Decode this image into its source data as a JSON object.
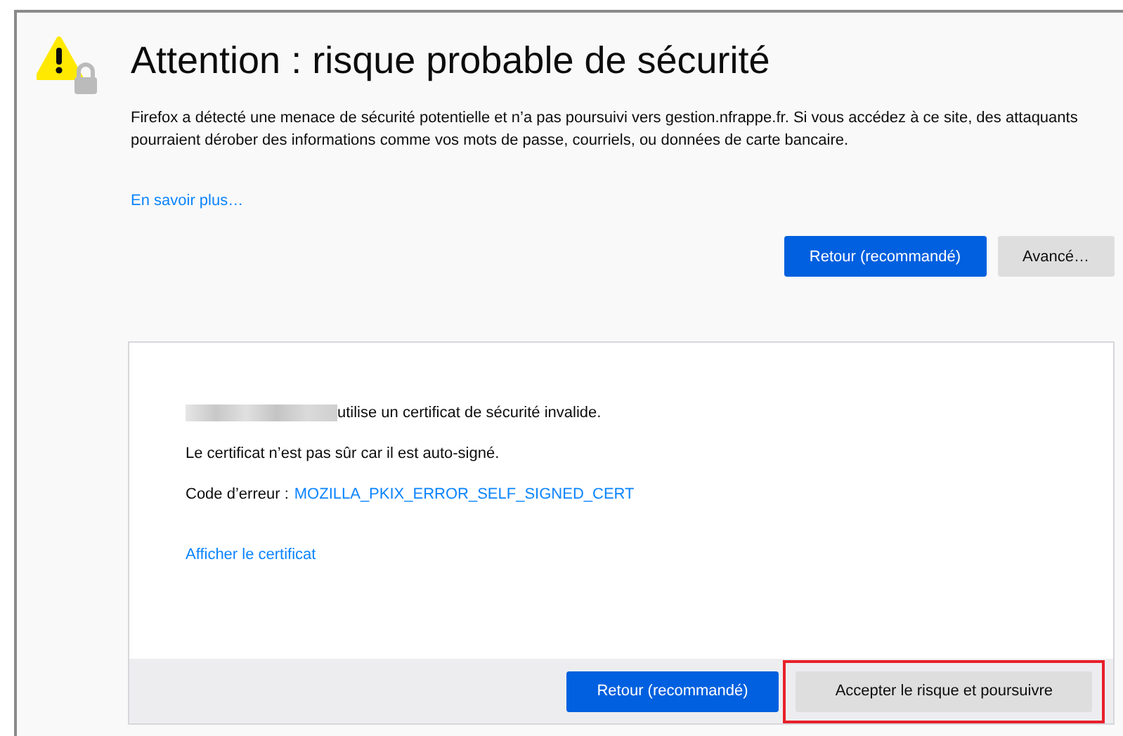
{
  "title": "Attention : risque probable de sécurité",
  "description": "Firefox a détecté une menace de sécurité potentielle et n’a pas poursuivi vers gestion.nfrappe.fr. Si vous accédez à ce site, des attaquants pourraient dérober des informations comme vos mots de passe, courriels, ou données de carte bancaire.",
  "learn_more": "En savoir plus…",
  "buttons": [
    {
      "label": "Retour (recommandé)",
      "kind": "primary"
    },
    {
      "label": "Avancé…",
      "kind": "secondary"
    }
  ],
  "advanced": {
    "invalid_cert": "utilise un certificat de sécurité invalide.",
    "reason": "Le certificat n’est pas sûr car il est auto-signé.",
    "error_label": "Code d’erreur :",
    "error_code": "MOZILLA_PKIX_ERROR_SELF_SIGNED_CERT",
    "view_cert": "Afficher le certificat",
    "buttons": [
      {
        "label": "Retour (recommandé)",
        "kind": "primary",
        "highlighted": false
      },
      {
        "label": "Accepter le risque et poursuivre",
        "kind": "secondary",
        "highlighted": true
      }
    ]
  }
}
